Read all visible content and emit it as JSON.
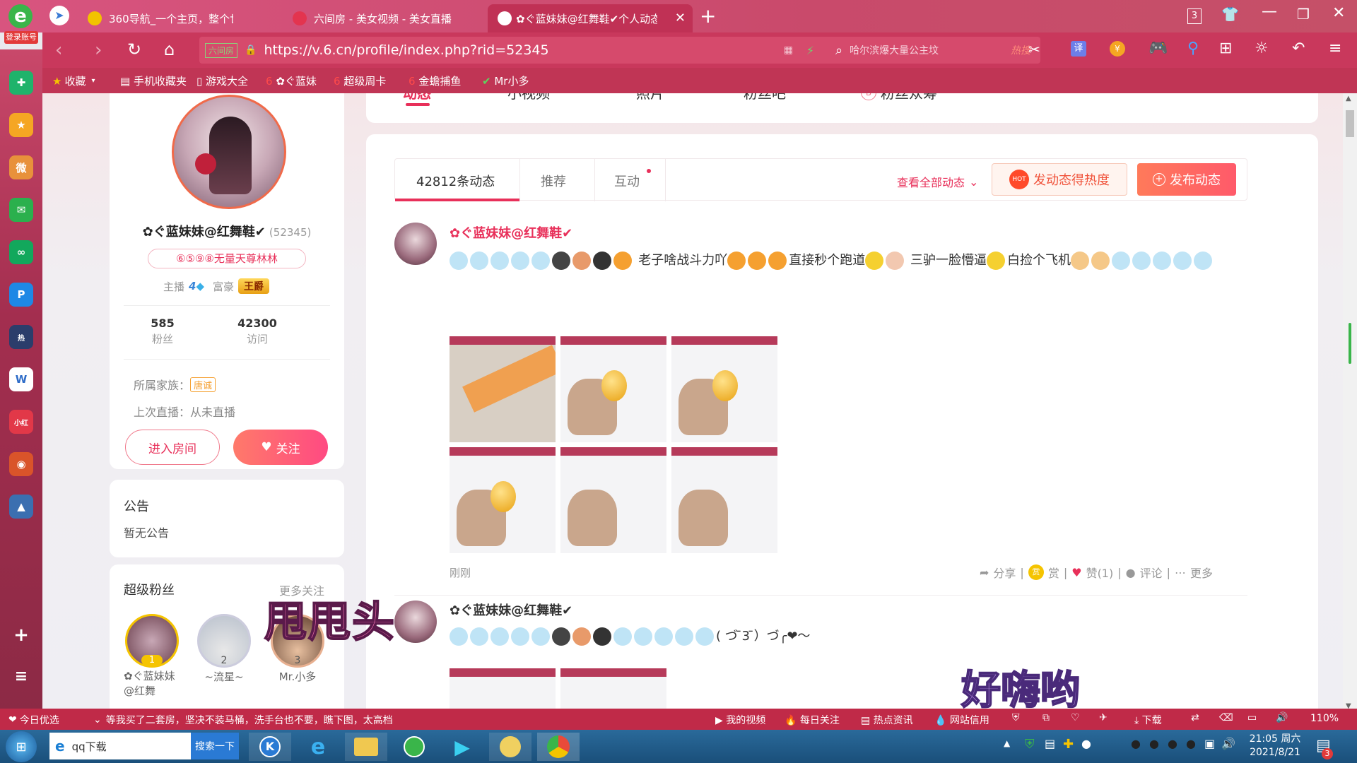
{
  "browser": {
    "login_badge": "登录账号",
    "tabs": [
      {
        "title": "360导航_一个主页，整个世界",
        "active": false
      },
      {
        "title": "六间房 - 美女视频 - 美女直播",
        "active": false
      },
      {
        "title": "✿ぐ蓝妹妹@红舞鞋✔个人动态",
        "active": true
      }
    ],
    "new_tab": "+",
    "tab_count": "3",
    "url": "https://v.6.cn/profile/index.php?rid=52345",
    "url_badge": "六间房",
    "search_placeholder": "哈尔滨爆大量公主坟",
    "search_hot": "热搜",
    "bookmarks": [
      "收藏",
      "手机收藏夹",
      "游戏大全",
      "✿ぐ蓝妹",
      "超级周卡",
      "金蟾捕鱼",
      "Mr小多"
    ],
    "translate_label": "译"
  },
  "sidebar_colors": {
    "accent": "#e8305a"
  },
  "profile": {
    "name": "✿ぐ蓝妹妹@红舞鞋✔",
    "rid": "(52345)",
    "signature": "⑥⑤⑨⑧无量天尊林林",
    "anchor_label": "主播",
    "anchor_level": "4",
    "rich_label": "富豪",
    "rich_badge": "王爵",
    "fans_count": "585",
    "fans_label": "粉丝",
    "visits_count": "42300",
    "visits_label": "访问",
    "family_label": "所属家族：",
    "family_badge": "唐诚",
    "last_live": "上次直播：从未直播",
    "enter_room": "进入房间",
    "follow": "关注"
  },
  "notice": {
    "title": "公告",
    "content": "暂无公告"
  },
  "superfans": {
    "title": "超级粉丝",
    "more": "更多关注",
    "list": [
      {
        "rank": "1",
        "name": "✿ぐ蓝妹妹@红舞"
      },
      {
        "rank": "2",
        "name": "~流星~"
      },
      {
        "rank": "3",
        "name": "Mr.小多"
      }
    ]
  },
  "topnav": [
    "动态",
    "小视频",
    "照片",
    "粉丝吧",
    "粉丝众筹"
  ],
  "feed": {
    "tabs": [
      "42812条动态",
      "推荐",
      "互动"
    ],
    "view_all": "查看全部动态",
    "boost": "发动态得热度",
    "hot_badge": "HOT",
    "publish": "发布动态",
    "posts": [
      {
        "author": "✿ぐ蓝妹妹@红舞鞋✔",
        "text_1": "老子啥战斗力吖",
        "text_2": "直接秒个跑道",
        "text_3": "三驴一脸懵逼",
        "text_4": "白捡个飞机",
        "time": "刚刚",
        "actions": [
          "分享",
          "赏",
          "赞(1)",
          "评论",
          "更多"
        ]
      },
      {
        "author": "✿ぐ蓝妹妹@红舞鞋✔",
        "text_tail": "( づ ̄3 ̄）づ╭❤～"
      }
    ]
  },
  "overlays": {
    "shake_head": "甩甩头",
    "so_high": "好嗨哟"
  },
  "statusbar": {
    "today": "今日优选",
    "news": "等我买了二套房，坚决不装马桶，洗手台也不要，瞧下图，太高档",
    "items": [
      "我的视频",
      "每日关注",
      "热点资讯",
      "网站信用",
      "下载"
    ],
    "zoom": "110%"
  },
  "taskbar": {
    "search_value": "qq下载",
    "search_btn": "搜索一下",
    "time": "21:05 周六",
    "date": "2021/8/21",
    "notify_count": "3"
  }
}
